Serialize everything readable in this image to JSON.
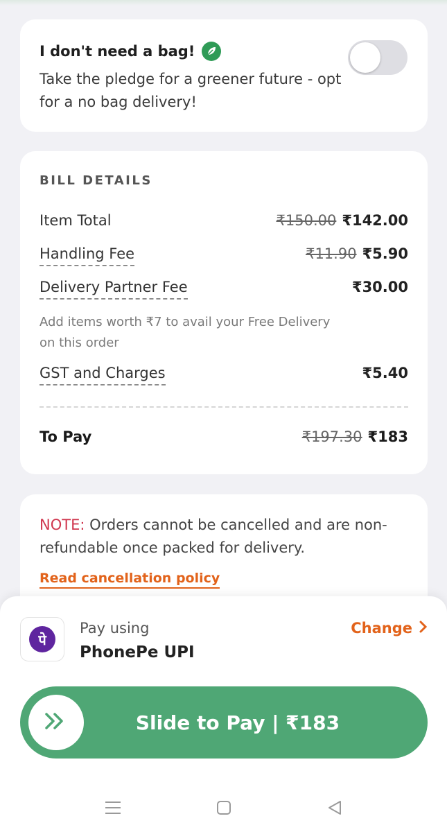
{
  "bag": {
    "title": "I don't need a bag!",
    "subtitle": "Take the pledge for a greener future - opt for a no bag delivery!",
    "toggle_on": false
  },
  "bill": {
    "heading": "BILL DETAILS",
    "item_total": {
      "label": "Item Total",
      "original": "₹150.00",
      "final": "₹142.00"
    },
    "handling_fee": {
      "label": "Handling Fee",
      "original": "₹11.90",
      "final": "₹5.90"
    },
    "delivery_fee": {
      "label": "Delivery Partner Fee",
      "final": "₹30.00"
    },
    "free_delivery_note": "Add items worth ₹7 to avail your Free Delivery on this order",
    "gst": {
      "label": "GST and Charges",
      "final": "₹5.40"
    },
    "to_pay": {
      "label": "To Pay",
      "original": "₹197.30",
      "final": "₹183"
    }
  },
  "note": {
    "label": "NOTE:",
    "text": " Orders cannot be cancelled and are non-refundable once packed for delivery.",
    "link": "Read cancellation policy"
  },
  "payment": {
    "pay_using": "Pay using",
    "method": "PhonePe UPI",
    "logo_glyph": "पे",
    "change_label": "Change",
    "slide_label": "Slide to Pay | ₹183"
  },
  "colors": {
    "accent_orange": "#e2631b",
    "note_red": "#d0364e",
    "slide_green": "#4fa775",
    "phonepe_purple": "#5f259f"
  }
}
